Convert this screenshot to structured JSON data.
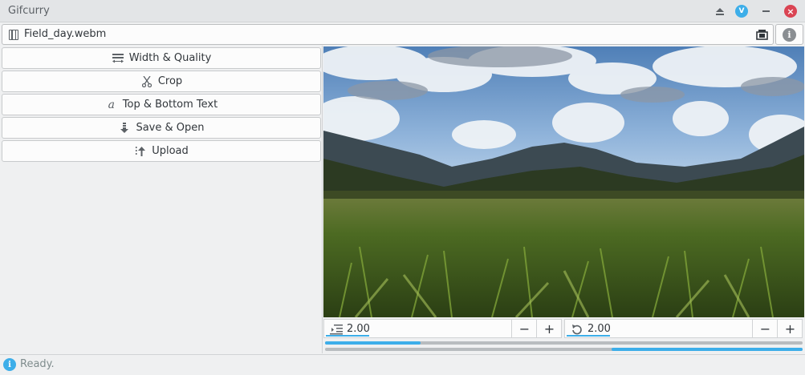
{
  "window": {
    "title": "Gifcurry"
  },
  "file": {
    "name": "Field_day.webm"
  },
  "sidebar": {
    "items": [
      {
        "label": "Width & Quality",
        "icon": "width-quality-icon"
      },
      {
        "label": "Crop",
        "icon": "scissors-icon"
      },
      {
        "label": "Top & Bottom Text",
        "icon": "text-a-icon"
      },
      {
        "label": "Save & Open",
        "icon": "save-download-icon"
      },
      {
        "label": "Upload",
        "icon": "upload-icon"
      }
    ]
  },
  "controls": {
    "start": {
      "value": "2.00",
      "icon": "start-time-icon"
    },
    "duration": {
      "value": "2.00",
      "icon": "duration-loop-icon"
    },
    "minus": "−",
    "plus": "+",
    "start_progress": 0.2,
    "end_progress": 0.6
  },
  "status": {
    "text": "Ready."
  },
  "colors": {
    "accent": "#3daee9",
    "close": "#da4453"
  }
}
